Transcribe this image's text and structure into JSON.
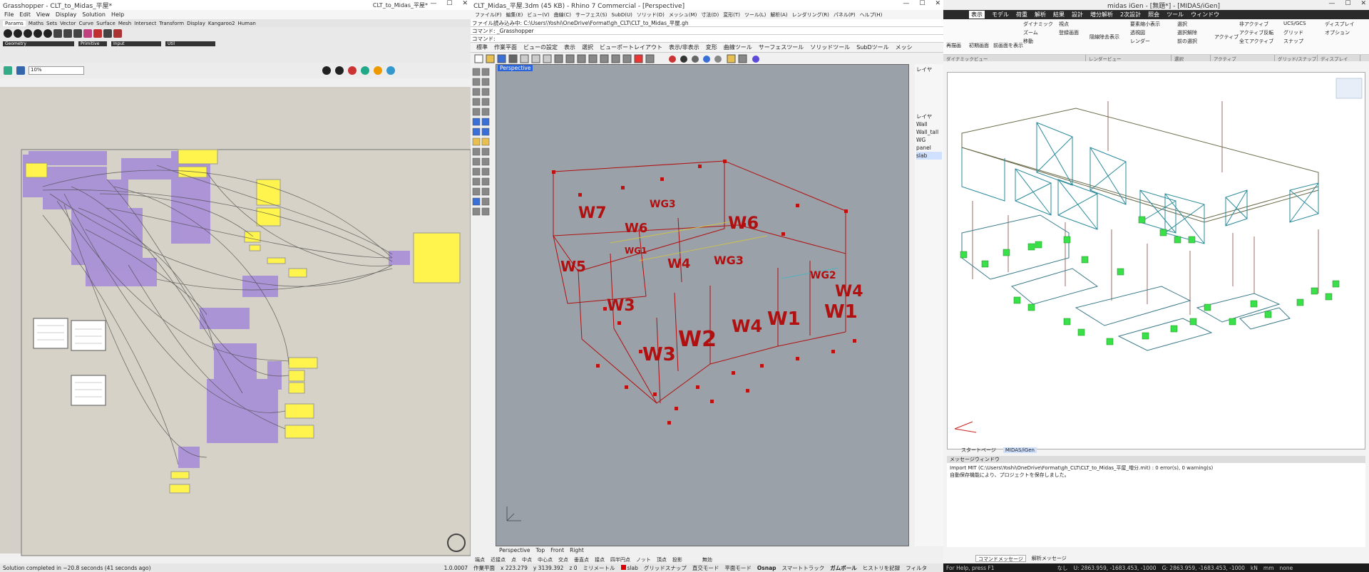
{
  "grasshopper": {
    "title": "Grasshopper - CLT_to_Midas_平屋*",
    "doc_name": "CLT_to_Midas_平屋*",
    "menu": [
      "File",
      "Edit",
      "View",
      "Display",
      "Solution",
      "Help"
    ],
    "tabs": [
      "Params",
      "Maths",
      "Sets",
      "Vector",
      "Curve",
      "Surface",
      "Mesh",
      "Intersect",
      "Transform",
      "Display",
      "Kangaroo2",
      "Human"
    ],
    "active_tab": "Params",
    "groups": [
      "Geometry",
      "Primitive",
      "Input",
      "Util"
    ],
    "zoom": "10%",
    "status": "Solution completed in ~20.8 seconds (41 seconds ago)",
    "version": "1.0.0007"
  },
  "rhino": {
    "title": "CLT_Midas_平屋.3dm (45 KB) - Rhino 7 Commercial - [Perspective]",
    "menu": [
      "ファイル(F)",
      "編集(E)",
      "ビュー(V)",
      "曲線(C)",
      "サーフェス(S)",
      "SubD(U)",
      "ソリッド(O)",
      "メッシュ(M)",
      "寸法(D)",
      "変形(T)",
      "ツール(L)",
      "解析(A)",
      "レンダリング(R)",
      "パネル(P)",
      "ヘルプ(H)"
    ],
    "cmd_history": "ファイル読み込み中: C:\\Users\\Yoshi\\OneDrive\\Format\\gh_CLT\\CLT_to_Midas_平屋.gh",
    "cmd_line": "コマンド: _Grasshopper",
    "cmd_prompt": "コマンド:",
    "tabs": [
      "標準",
      "作業平面",
      "ビューの設定",
      "表示",
      "選択",
      "ビューポートレイアウト",
      "表示/非表示",
      "変形",
      "曲線ツール",
      "サーフェスツール",
      "ソリッドツール",
      "SubDツール",
      "メッシ"
    ],
    "viewport_title": "Perspective",
    "layers_title": "レイヤ",
    "layers": [
      "Wall",
      "Wall_tall",
      "WG",
      "panel",
      "slab"
    ],
    "selected_layer": "slab",
    "viewport_tabs": [
      "Perspective",
      "Top",
      "Front",
      "Right"
    ],
    "osnap": [
      "端点",
      "近接点",
      "点",
      "中点",
      "中心点",
      "交点",
      "垂直点",
      "接点",
      "四半円点",
      "ノット",
      "頂点",
      "投影",
      "無効"
    ],
    "status_items": [
      "作業平面",
      "x 223.279",
      "y 3139.392",
      "z 0",
      "ミリメートル",
      "slab",
      "グリッドスナップ",
      "直交モード",
      "平面モード",
      "Osnap",
      "スマートトラック",
      "ガムボール",
      "ヒストリを記録",
      "フィルタ"
    ],
    "wall_labels": [
      "W7",
      "W6",
      "WG3",
      "WG1",
      "W5",
      "W3",
      "W4",
      "W3",
      "W2",
      "W4",
      "W1",
      "WG2",
      "W4",
      "W1",
      "W6",
      "WG3"
    ]
  },
  "midas": {
    "title": "midas iGen - [無題*] - [MIDAS/iGen]",
    "menu": [
      "表示",
      "モデル",
      "荷重",
      "解析",
      "結果",
      "設計",
      "増分解析",
      "2次設計",
      "照会",
      "ツール",
      "ウィンドウ"
    ],
    "active_menu": "表示",
    "ribbon_items": [
      "再描画",
      "初期画面",
      "前画面を表示",
      "ダイナミック",
      "ズーム",
      "移動",
      "視点",
      "登録画面",
      "隠線除去表示",
      "要素縮小表示",
      "透視図",
      "レンダー",
      "選択",
      "選択解除",
      "前の選択",
      "アクティブ",
      "非アクティブ",
      "アクティブ反転",
      "全てアクティブ",
      "UCS/GCS",
      "グリッド",
      "スナップ",
      "ディスプレイ",
      "オプション"
    ],
    "ribbon_groups": [
      "ダイナミックビュー",
      "レンダービュー",
      "選択",
      "アクティブ",
      "グリッド/スナップ",
      "ディスプレイ"
    ],
    "doc_tabs": [
      "スタートページ",
      "MIDAS/iGen"
    ],
    "active_doc_tab": "MIDAS/iGen",
    "msg_title": "メッセージウィンドウ",
    "messages": [
      "Import MIT (C:\\Users\\Yoshi\\OneDrive\\Format\\gh_CLT\\CLT_to_Midas_平屋_増分.mit) : 0 error(s), 0 warning(s)",
      "自動保存機能により、プロジェクトを保存しました。"
    ],
    "msg_tabs": [
      "コマンドメッセージ",
      "解析メッセージ"
    ],
    "status_help": "For Help, press F1",
    "status_none": "なし",
    "status_u": "U: 2863.959, -1683.453, -1000",
    "status_g": "G: 2863.959, -1683.453, -1000",
    "unit_force": "kN",
    "unit_length": "mm",
    "status_none2": "none"
  }
}
